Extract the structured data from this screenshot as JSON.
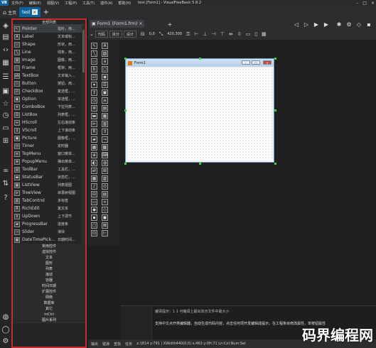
{
  "menubar": {
    "logo": "VB",
    "items": [
      "文件(F)",
      "编辑(E)",
      "视图(V)",
      "工程(P)",
      "工具(T)",
      "插件(A)",
      "帮助(H)"
    ],
    "title": "test [Form1] - VisualFreeBasic 5.8.2"
  },
  "tabs": [
    {
      "label": "主页",
      "active": false
    },
    {
      "label": "test",
      "active": true
    }
  ],
  "toolbox": {
    "header": "全部列表",
    "tools": [
      {
        "name": "Pointer",
        "desc": "指针，用..."
      },
      {
        "name": "Label",
        "desc": "文本或标..."
      },
      {
        "name": "Shape",
        "desc": "形状，用..."
      },
      {
        "name": "Line",
        "desc": "线条，用..."
      },
      {
        "name": "Image",
        "desc": "图像，用..."
      },
      {
        "name": "Frame",
        "desc": "框架，用..."
      },
      {
        "name": "TextBox",
        "desc": "文本输入..."
      },
      {
        "name": "Button",
        "desc": "按钮，用..."
      },
      {
        "name": "CheckBox",
        "desc": "复选框，..."
      },
      {
        "name": "Option",
        "desc": "单选框，..."
      },
      {
        "name": "ComboBox",
        "desc": "下拉列表..."
      },
      {
        "name": "ListBox",
        "desc": "列表框，..."
      },
      {
        "name": "HScroll",
        "desc": "左右滚动条"
      },
      {
        "name": "VScroll",
        "desc": "上下滚动条"
      },
      {
        "name": "Picture",
        "desc": "图像框，..."
      },
      {
        "name": "Timer",
        "desc": "定时器"
      },
      {
        "name": "TopMenu",
        "desc": "窗口菜单..."
      },
      {
        "name": "PopupMenu",
        "desc": "弹出菜单..."
      },
      {
        "name": "ToolBar",
        "desc": "工具栏，..."
      },
      {
        "name": "StatusBar",
        "desc": "状态栏，..."
      },
      {
        "name": "ListView",
        "desc": "列表视图"
      },
      {
        "name": "TreeView",
        "desc": "目录树视图"
      },
      {
        "name": "TabControl",
        "desc": "多标签"
      },
      {
        "name": "RichEdit",
        "desc": "富文本"
      },
      {
        "name": "UpDown",
        "desc": "上下调节"
      },
      {
        "name": "ProgressBar",
        "desc": "进度条"
      },
      {
        "name": "Slider",
        "desc": "滑块"
      },
      {
        "name": "DateTimePick...",
        "desc": "日期时间..."
      }
    ],
    "categories": [
      "常用控件",
      "虚拟控件",
      "文本",
      "图形",
      "列表",
      "滚动",
      "容器",
      "时间日期",
      "扩展控件",
      "网络",
      "数据库",
      "其它",
      "mCtrl",
      "图片系列"
    ]
  },
  "designer": {
    "tab_label": "Form1 (Form1.frm)",
    "view_buttons": [
      "代码",
      "拆分",
      "设计"
    ],
    "x_value": "0,0",
    "size_value": "420,300",
    "form_title": "Form1"
  },
  "output": {
    "line1": "编译提示：1 1 可编译上最出向示文件中最大小",
    "line2": "支持中文点开类编辑器，自动生成代码内容，点击任何项开发编辑成提示，在工程条目修改属性，单按钮属性"
  },
  "statusbar": {
    "items": [
      "输出",
      "错误",
      "查找",
      "任务"
    ],
    "position": "x:1814 y:791 | XWidth440(0,0) x:463 y:0H:71 Ln:Col:Num:Sel"
  },
  "watermark": "码界编程网",
  "colors": {
    "accent": "#0e639c",
    "highlight_border": "#c92a2a",
    "handle": "#3cd13c"
  }
}
